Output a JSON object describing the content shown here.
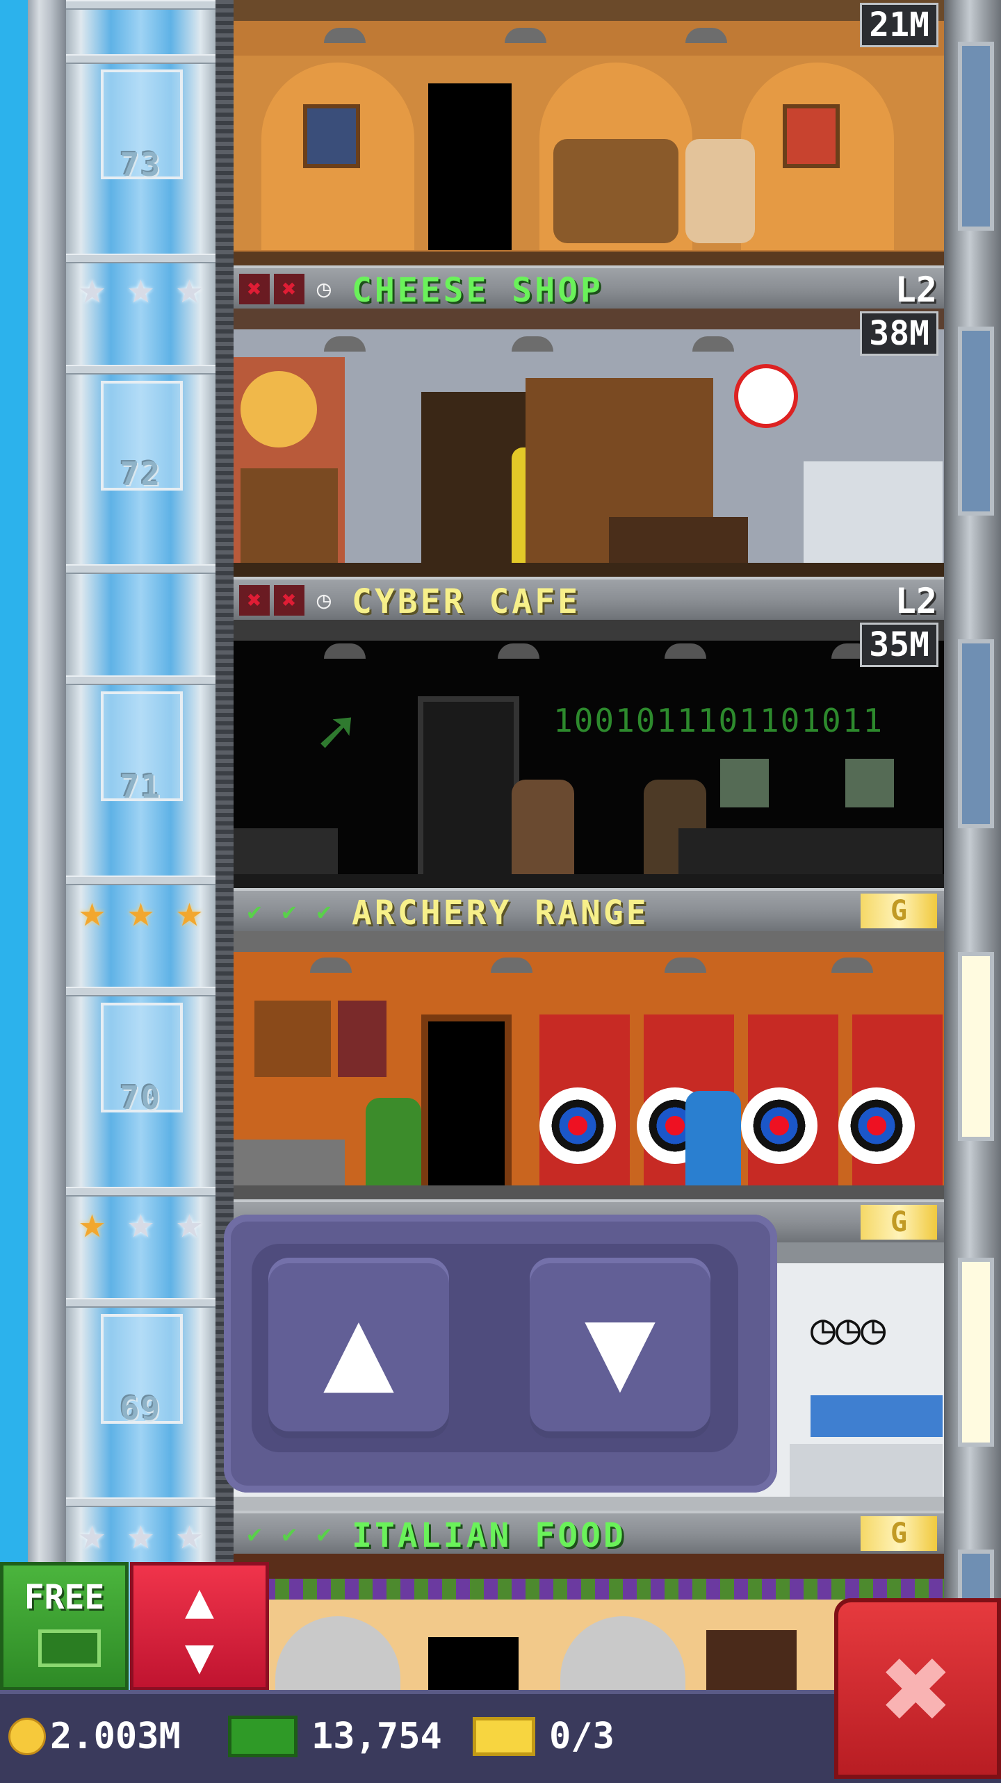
{
  "floors": [
    {
      "floor_number": "73",
      "name": "",
      "level": "",
      "badge": "21M"
    },
    {
      "floor_number": "72",
      "name": "CHEESE SHOP",
      "level": "L2",
      "badge": "38M"
    },
    {
      "floor_number": "71",
      "name": "CYBER CAFE",
      "level": "L2",
      "badge": "35M",
      "screen_text": "1001011101101011"
    },
    {
      "floor_number": "70",
      "name": "ARCHERY RANGE",
      "level": "G"
    },
    {
      "floor_number": "69",
      "name": "",
      "level": "G"
    },
    {
      "floor_number": "",
      "name": "ITALIAN FOOD",
      "level": "G"
    }
  ],
  "icons": {
    "cross": "✖",
    "clock": "◷",
    "check": "✔",
    "star": "★",
    "arrow_up": "▲",
    "arrow_down": "▼",
    "elevator": "▲\n▼",
    "close": "✖"
  },
  "elevator_controls": {
    "up_label": "▲",
    "down_label": "▼"
  },
  "buttons": {
    "free_label": "FREE",
    "close_label": "✖"
  },
  "status_bar": {
    "coins": "2.003M",
    "bux": "13,754",
    "vip": "0/3"
  },
  "colors": {
    "name_green": "#6af25a",
    "name_yellow": "#f7f08a",
    "panel_purple": "#5f5c90",
    "close_red": "#e63a3e"
  }
}
